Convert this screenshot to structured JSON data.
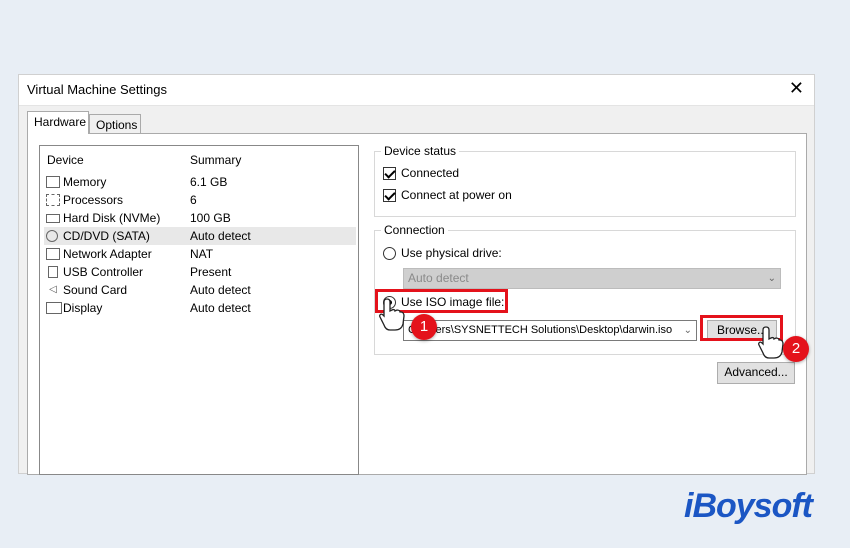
{
  "window": {
    "title": "Virtual Machine Settings",
    "close_glyph": "✕"
  },
  "tabs": [
    {
      "label": "Hardware",
      "active": true
    },
    {
      "label": "Options",
      "active": false
    }
  ],
  "device_list": {
    "headers": {
      "device": "Device",
      "summary": "Summary"
    },
    "rows": [
      {
        "icon": "memory-icon",
        "name": "Memory",
        "summary": "6.1 GB"
      },
      {
        "icon": "processor-icon",
        "name": "Processors",
        "summary": "6"
      },
      {
        "icon": "hard-disk-icon",
        "name": "Hard Disk (NVMe)",
        "summary": "100 GB"
      },
      {
        "icon": "cd-dvd-icon",
        "name": "CD/DVD (SATA)",
        "summary": "Auto detect",
        "selected": true
      },
      {
        "icon": "network-adapter-icon",
        "name": "Network Adapter",
        "summary": "NAT"
      },
      {
        "icon": "usb-icon",
        "name": "USB Controller",
        "summary": "Present"
      },
      {
        "icon": "sound-card-icon",
        "name": "Sound Card",
        "summary": "Auto detect"
      },
      {
        "icon": "display-icon",
        "name": "Display",
        "summary": "Auto detect"
      }
    ]
  },
  "device_status": {
    "label": "Device status",
    "connected": {
      "label": "Connected",
      "checked": true
    },
    "connect_at_power_on": {
      "label": "Connect at power on",
      "checked": true
    }
  },
  "connection": {
    "label": "Connection",
    "physical_drive": {
      "label": "Use physical drive:",
      "selected": false
    },
    "physical_drive_select": {
      "value": "Auto detect"
    },
    "iso_image": {
      "label": "Use ISO image file:",
      "selected": true
    },
    "iso_path": {
      "value": "C:\\Users\\SYSNETTECH Solutions\\Desktop\\darwin.iso"
    },
    "browse_label": "Browse...",
    "advanced_label": "Advanced..."
  },
  "annotations": {
    "marker_1": "1",
    "marker_2": "2",
    "accent": "#e4121b"
  },
  "brand": {
    "logo_text": "iBoysoft",
    "color": "#1b56c4"
  }
}
